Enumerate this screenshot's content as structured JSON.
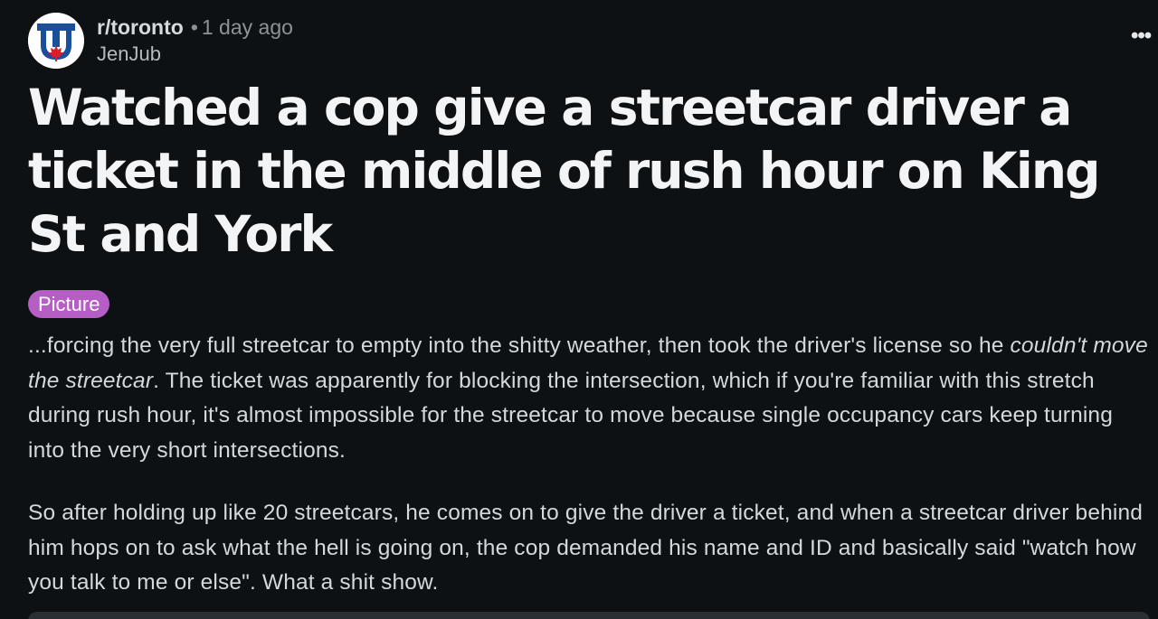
{
  "post": {
    "subreddit": "r/toronto",
    "separator": "•",
    "time": "1 day ago",
    "author": "JenJub",
    "more_label": "•••",
    "title": "Watched a cop give a streetcar driver a ticket in the middle of rush hour on King St and York",
    "flair": "Picture",
    "body": {
      "p1_before": "...forcing the very full streetcar to empty into the shitty weather, then took the driver's license so he ",
      "p1_emphasis": "couldn't move the streetcar",
      "p1_after": ". The ticket was apparently for blocking the intersection, which if you're familiar with this stretch during rush hour, it's almost impossible for the streetcar to move because single occupancy cars keep turning into the very short intersections.",
      "p2": "So after holding up like 20 streetcars, he comes on to give the driver a ticket, and when a streetcar driver behind him hops on to ask what the hell is going on, the cop demanded his name and ID and basically said \"watch how you talk to me or else\". What a shit show."
    }
  },
  "colors": {
    "background": "#0e1113",
    "flair_bg": "#b65ec6",
    "avatar_blue": "#1a4f9c",
    "maple_red": "#d8202a"
  },
  "icons": {
    "avatar": "subreddit-avatar",
    "more": "more-options-icon"
  }
}
